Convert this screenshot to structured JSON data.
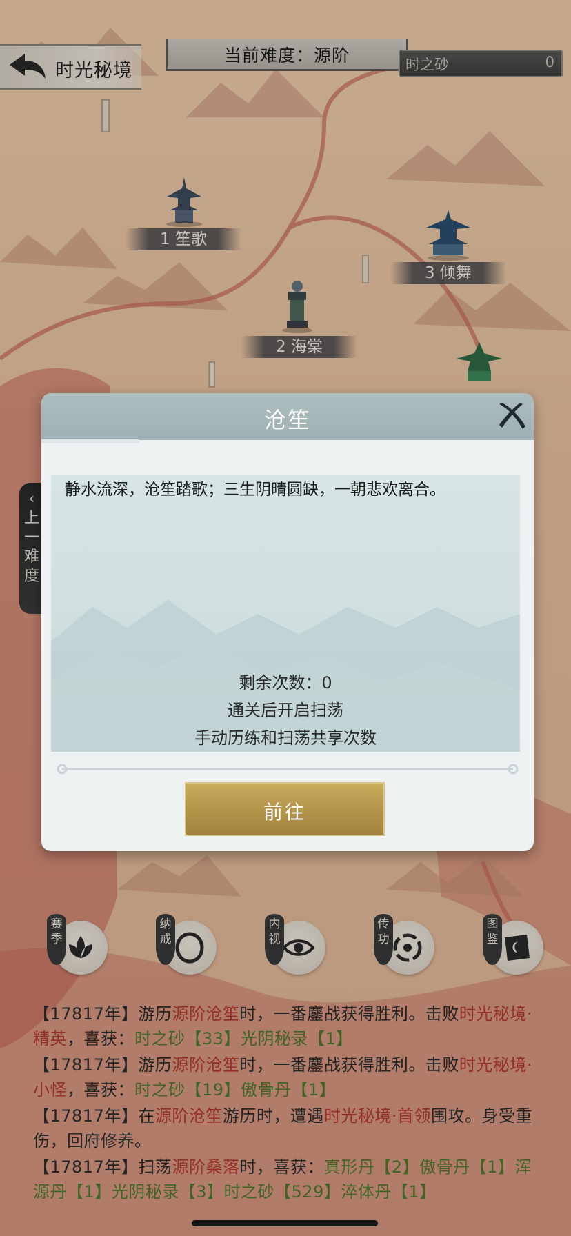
{
  "header": {
    "back_title": "时光秘境",
    "difficulty_text": "当前难度：源阶",
    "sand_label": "时之砂",
    "sand_value": "0"
  },
  "map_nodes": [
    {
      "label": "1 笙歌"
    },
    {
      "label": "2 海棠"
    },
    {
      "label": "3 倾舞"
    }
  ],
  "side_tab": {
    "chars": [
      "上",
      "一",
      "难",
      "度"
    ]
  },
  "features": [
    {
      "tag": "赛季",
      "icon": "lotus-icon"
    },
    {
      "tag": "纳戒",
      "icon": "ring-icon"
    },
    {
      "tag": "内视",
      "icon": "eye-icon"
    },
    {
      "tag": "传功",
      "icon": "swirl-icon"
    },
    {
      "tag": "图鉴",
      "icon": "book-icon"
    }
  ],
  "log": [
    {
      "parts": [
        {
          "t": "【17817年】游历",
          "c": ""
        },
        {
          "t": "源阶沧笙",
          "c": "red"
        },
        {
          "t": "时，一番鏖战获得胜利。击败",
          "c": ""
        },
        {
          "t": "时光秘境·精英",
          "c": "red"
        },
        {
          "t": "，喜获：",
          "c": ""
        },
        {
          "t": "时之砂【33】光阴秘录【1】",
          "c": "green"
        }
      ]
    },
    {
      "parts": [
        {
          "t": "【17817年】游历",
          "c": ""
        },
        {
          "t": "源阶沧笙",
          "c": "red"
        },
        {
          "t": "时，一番鏖战获得胜利。击败",
          "c": ""
        },
        {
          "t": "时光秘境·小怪",
          "c": "red"
        },
        {
          "t": "，喜获：",
          "c": ""
        },
        {
          "t": "时之砂【19】傲骨丹【1】",
          "c": "green"
        }
      ]
    },
    {
      "parts": [
        {
          "t": "【17817年】在",
          "c": ""
        },
        {
          "t": "源阶沧笙",
          "c": "red"
        },
        {
          "t": "游历时，遭遇",
          "c": ""
        },
        {
          "t": "时光秘境·首领",
          "c": "red"
        },
        {
          "t": "围攻。身受重伤，回府修养。",
          "c": ""
        }
      ]
    },
    {
      "parts": [
        {
          "t": "【17817年】扫荡",
          "c": ""
        },
        {
          "t": "源阶桑落",
          "c": "red"
        },
        {
          "t": "时，喜获：",
          "c": ""
        },
        {
          "t": "真形丹【2】傲骨丹【1】浑源丹【1】光阴秘录【3】时之砂【529】淬体丹【1】",
          "c": "green"
        }
      ]
    }
  ],
  "modal": {
    "title": "沧笙",
    "description": "静水流深，沧笙踏歌；三生阴晴圆缺，一朝悲欢离合。",
    "remaining": "剩余次数：0",
    "sweep_note": "通关后开启扫荡",
    "shared_note": "手动历练和扫荡共享次数",
    "go_label": "前往"
  }
}
